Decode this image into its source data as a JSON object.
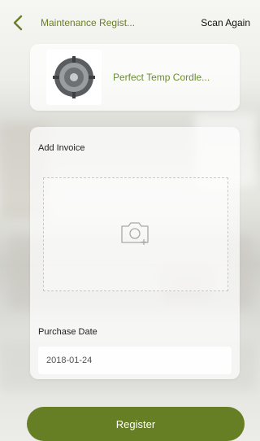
{
  "header": {
    "title": "Maintenance Regist...",
    "scan_again_label": "Scan Again"
  },
  "product": {
    "name": "Perfect Temp Cordle..."
  },
  "form": {
    "invoice_label": "Add Invoice",
    "purchase_date_label": "Purchase Date",
    "purchase_date_value": "2018-01-24"
  },
  "actions": {
    "register_label": "Register"
  },
  "colors": {
    "accent": "#667e24",
    "title_green": "#6b7d2a"
  },
  "icons": {
    "back": "chevron-left-icon",
    "camera_add": "camera-add-icon",
    "product": "product-image"
  }
}
